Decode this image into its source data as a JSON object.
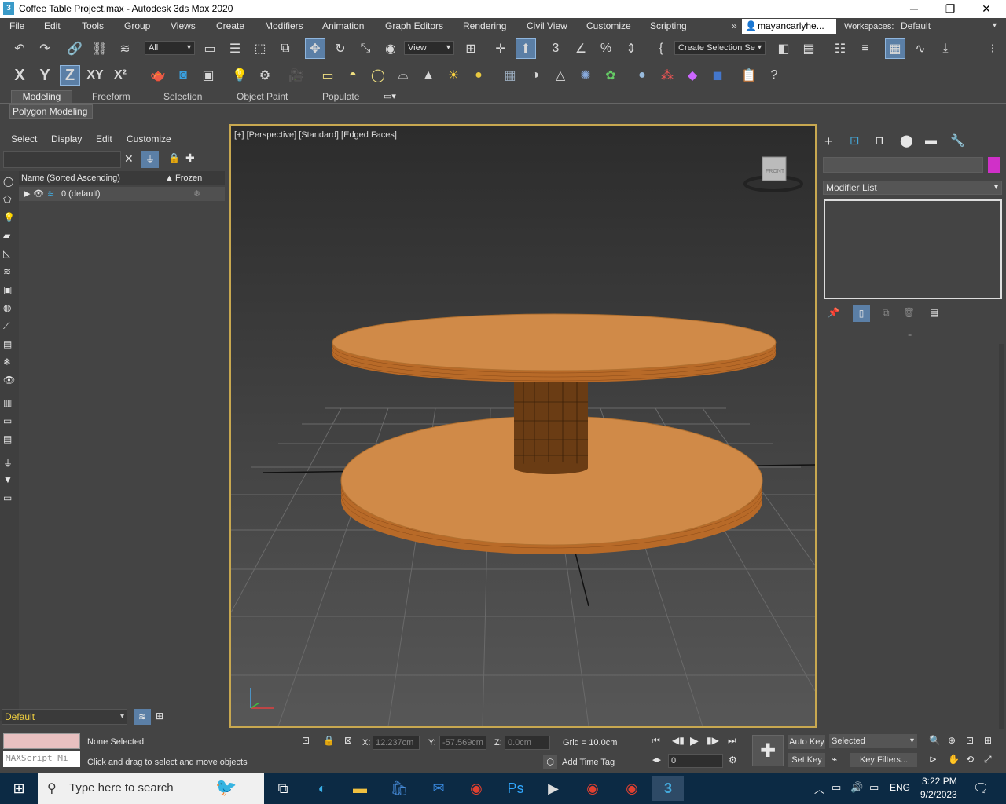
{
  "window": {
    "title": "Coffee Table Project.max - Autodesk 3ds Max 2020",
    "logo_glyph": "3",
    "minimize": "─",
    "maximize": "❐",
    "close": "✕"
  },
  "menu": {
    "items": [
      "File",
      "Edit",
      "Tools",
      "Group",
      "Views",
      "Create",
      "Modifiers",
      "Animation",
      "Graph Editors",
      "Rendering",
      "Civil View",
      "Customize",
      "Scripting"
    ],
    "overflow": "»",
    "user": "mayancarlyhe...",
    "workspaces_label": "Workspaces:",
    "workspace_value": "Default"
  },
  "toolbar1": {
    "selection_filter": "All",
    "reference_coord": "View",
    "named_selection": "Create Selection Se"
  },
  "toolbar2": {
    "axis_x": "X",
    "axis_y": "Y",
    "axis_z": "Z",
    "axis_xy": "XY",
    "axis_xz": "X²"
  },
  "ribbon": {
    "tabs": [
      "Modeling",
      "Freeform",
      "Selection",
      "Object Paint",
      "Populate"
    ],
    "active_tab": "Modeling",
    "subtab": "Polygon Modeling"
  },
  "scene_explorer": {
    "menu": [
      "Select",
      "Display",
      "Edit",
      "Customize"
    ],
    "col_name": "Name (Sorted Ascending)",
    "col_frozen": "Frozen",
    "rows": [
      {
        "name": "0 (default)"
      }
    ],
    "layer_dropdown": "Default"
  },
  "viewport": {
    "label": "[+] [Perspective] [Standard] [Edged Faces]",
    "viewcube_label": "FRONT",
    "colors": {
      "wood_top": "#d08a48",
      "wood_side": "#b86a28",
      "cylinder": "#6a3c14"
    }
  },
  "command_panel": {
    "modifier_list": "Modifier List"
  },
  "status": {
    "selection": "None Selected",
    "prompt": "Click and drag to select and move objects",
    "maxscript": "MAXScript Mi",
    "x_label": "X:",
    "x_value": "12.237cm",
    "y_label": "Y:",
    "y_value": "-57.569cm",
    "z_label": "Z:",
    "z_value": "0.0cm",
    "grid": "Grid = 10.0cm",
    "add_time_tag": "Add Time Tag",
    "auto_key": "Auto Key",
    "set_key": "Set Key",
    "selected": "Selected",
    "key_filters": "Key Filters...",
    "frame": "0"
  },
  "taskbar": {
    "search_placeholder": "Type here to search",
    "lang": "ENG",
    "time": "3:22 PM",
    "date": "9/2/2023"
  }
}
